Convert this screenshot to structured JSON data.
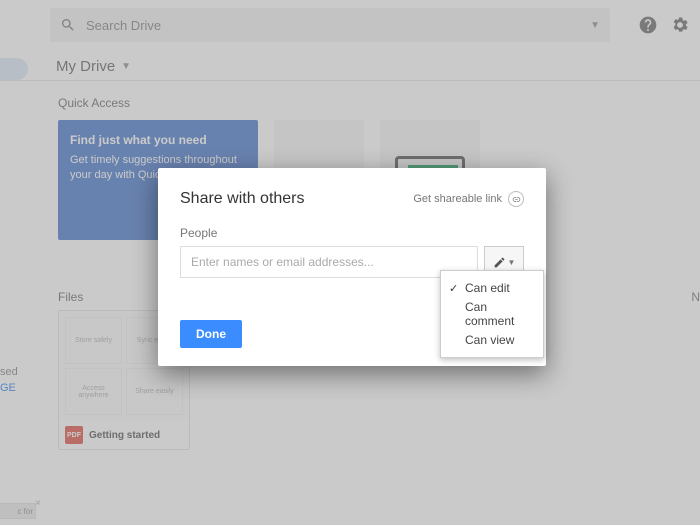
{
  "search": {
    "placeholder": "Search Drive"
  },
  "breadcrumb": {
    "title": "My Drive"
  },
  "sections": {
    "quick_access": "Quick Access",
    "files": "Files"
  },
  "qa_card": {
    "title": "Find just what you need",
    "body": "Get timely suggestions throughout your day with Quick Access"
  },
  "sidebar": {
    "used_label": "sed",
    "upgrade_label": "GE"
  },
  "file": {
    "name": "Getting started",
    "badge": "PDF",
    "thumb": [
      "Store safely",
      "Sync easily",
      "Access anywhere",
      "Share easily"
    ]
  },
  "toast": {
    "text": "c for"
  },
  "rightcut": "N",
  "modal": {
    "title": "Share with others",
    "link_label": "Get shareable link",
    "people_label": "People",
    "input_placeholder": "Enter names or email addresses...",
    "done_label": "Done"
  },
  "dropdown": {
    "items": [
      "Can edit",
      "Can comment",
      "Can view"
    ],
    "selected": 0
  }
}
